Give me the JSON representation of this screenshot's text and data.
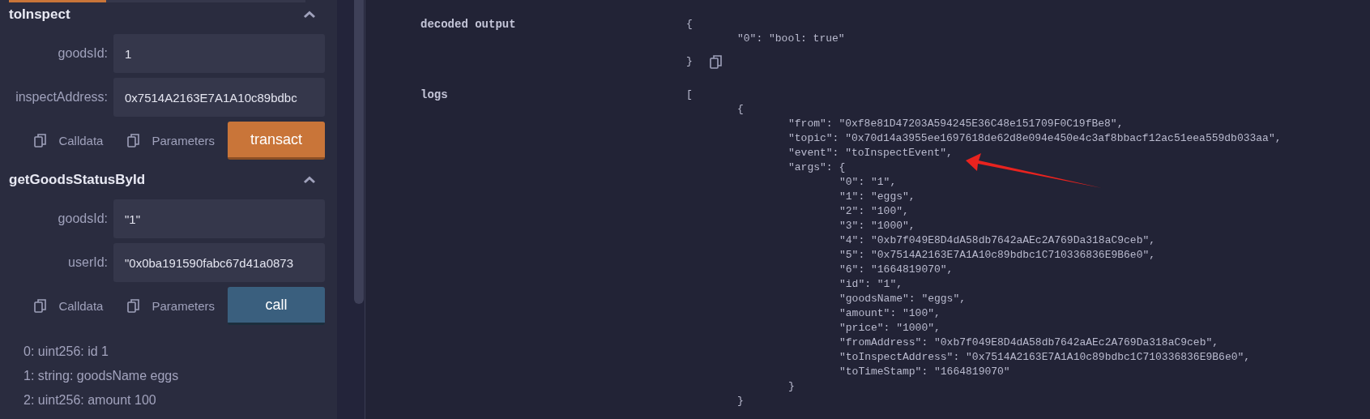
{
  "functions": [
    {
      "name": "toInspect",
      "expanded": true,
      "inputs": [
        {
          "label": "goodsId:",
          "value": "1"
        },
        {
          "label": "inspectAddress:",
          "value": "0x7514A2163E7A1A10c89bdbc"
        }
      ],
      "actions": [
        "Calldata",
        "Parameters"
      ],
      "button": {
        "label": "transact",
        "kind": "transact"
      }
    },
    {
      "name": "getGoodsStatusById",
      "expanded": true,
      "inputs": [
        {
          "label": "goodsId:",
          "value": "\"1\""
        },
        {
          "label": "userId:",
          "value": "\"0x0ba191590fabc67d41a0873"
        }
      ],
      "actions": [
        "Calldata",
        "Parameters"
      ],
      "button": {
        "label": "call",
        "kind": "call"
      }
    }
  ],
  "results": [
    "0: uint256: id 1",
    "1: string: goodsName eggs",
    "2: uint256: amount 100"
  ],
  "output": [
    {
      "label": "decoded output",
      "copy_button": true,
      "value": {
        "open": "{",
        "children": [
          {
            "text": "\"0\": \"bool: true\""
          }
        ],
        "close": "}"
      }
    },
    {
      "label": "logs",
      "copy_button": false,
      "value": {
        "open": "[",
        "children": [
          {
            "open": "{",
            "children": [
              {
                "text": "\"from\": \"0xf8e81D47203A594245E36C48e151709F0C19fBe8\","
              },
              {
                "text": "\"topic\": \"0x70d14a3955ee1697618de62d8e094e450e4c3af8bbacf12ac51eea559db033aa\","
              },
              {
                "text": "\"event\": \"toInspectEvent\","
              },
              {
                "open": "\"args\": {",
                "children": [
                  {
                    "text": "\"0\": \"1\","
                  },
                  {
                    "text": "\"1\": \"eggs\","
                  },
                  {
                    "text": "\"2\": \"100\","
                  },
                  {
                    "text": "\"3\": \"1000\","
                  },
                  {
                    "text": "\"4\": \"0xb7f049E8D4dA58db7642aAEc2A769Da318aC9ceb\","
                  },
                  {
                    "text": "\"5\": \"0x7514A2163E7A1A10c89bdbc1C710336836E9B6e0\","
                  },
                  {
                    "text": "\"6\": \"1664819070\","
                  },
                  {
                    "text": "\"id\": \"1\","
                  },
                  {
                    "text": "\"goodsName\": \"eggs\","
                  },
                  {
                    "text": "\"amount\": \"100\","
                  },
                  {
                    "text": "\"price\": \"1000\","
                  },
                  {
                    "text": "\"fromAddress\": \"0xb7f049E8D4dA58db7642aAEc2A769Da318aC9ceb\","
                  },
                  {
                    "text": "\"toInspectAddress\": \"0x7514A2163E7A1A10c89bdbc1C710336836E9B6e0\","
                  },
                  {
                    "text": "\"toTimeStamp\": \"1664819070\""
                  }
                ],
                "close": "}"
              }
            ],
            "close": "}"
          }
        ]
      }
    }
  ]
}
